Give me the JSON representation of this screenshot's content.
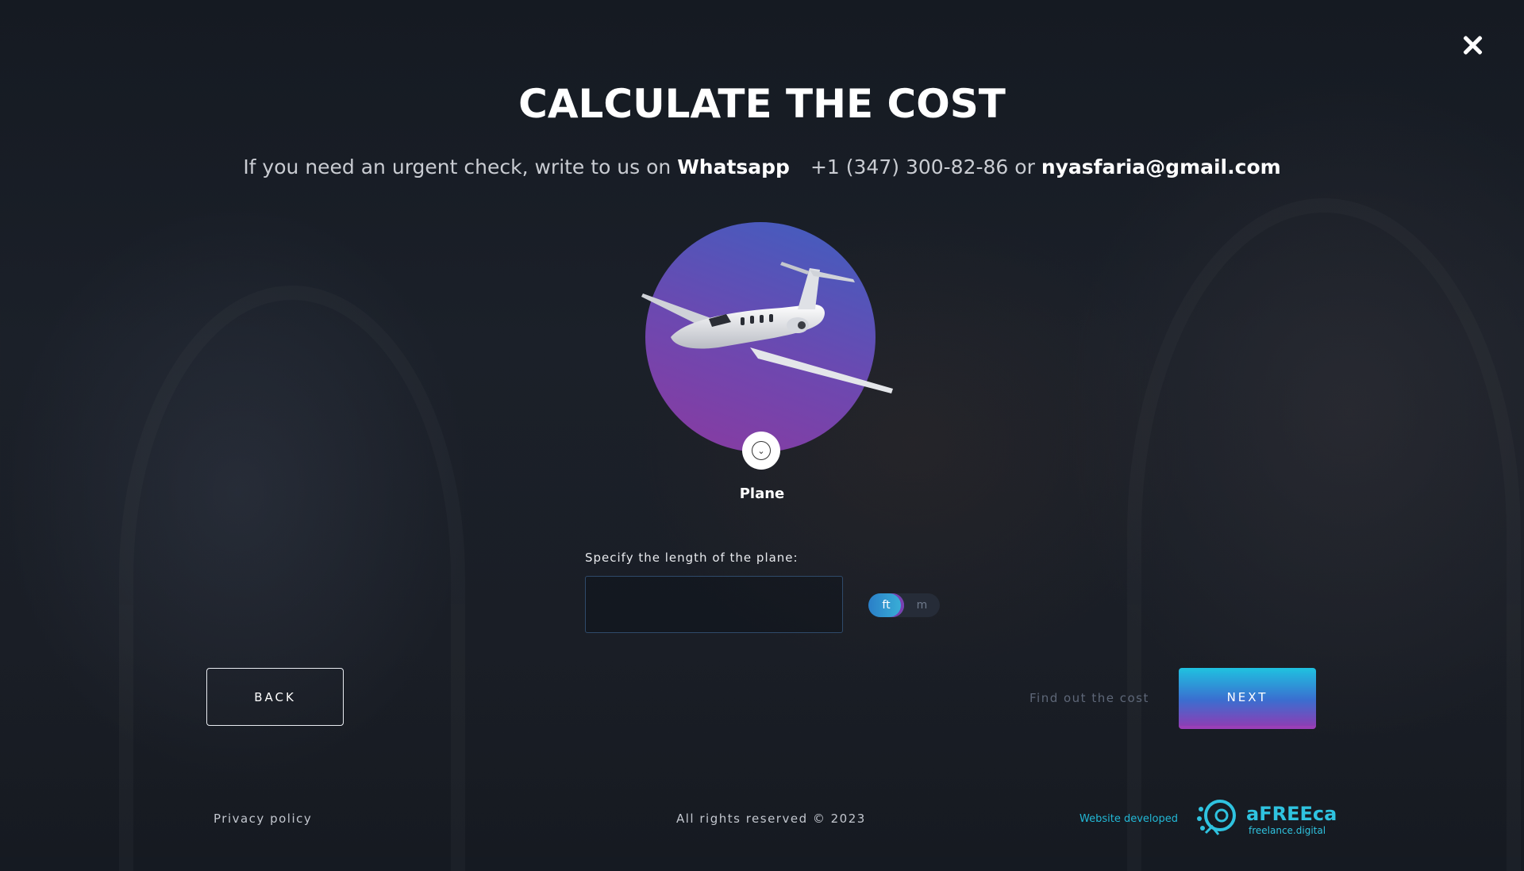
{
  "modal": {
    "title": "CALCULATE THE COST",
    "subtitle_prefix": "If you need an urgent check, write to us on",
    "whatsapp_label": "Whatsapp",
    "phone": "+1 (347) 300-82-86",
    "or": "or",
    "email": "nyasfaria@gmail.com"
  },
  "vehicle": {
    "name": "Plane",
    "icon": "plane-image",
    "dropdown_icon": "chevron-down-icon"
  },
  "length_field": {
    "label": "Specify the length of the plane:",
    "value": "",
    "placeholder": "",
    "units": [
      {
        "label": "ft",
        "selected": true
      },
      {
        "label": "m",
        "selected": false
      }
    ]
  },
  "actions": {
    "back": "BACK",
    "find_cost": "Find out the cost",
    "next": "NEXT"
  },
  "footer": {
    "privacy": "Privacy policy",
    "copyright": "All rights reserved © 2023",
    "developed": "Website developed",
    "brand": "aFREEca",
    "brand_sub": "freelance.digital"
  },
  "colors": {
    "accent_cyan": "#1fc2e0",
    "accent_purple": "#8b3fb5",
    "accent_blue": "#3a6fd0"
  }
}
